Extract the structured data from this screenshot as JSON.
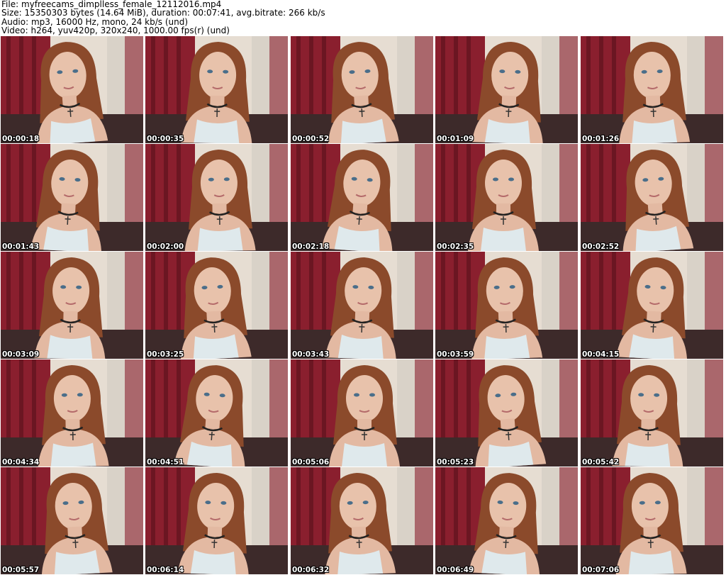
{
  "header": {
    "file_line": "File: myfreecams_dimplless_female_12112016.mp4",
    "size_line": "Size: 15350303 bytes (14.64 MiB), duration: 00:07:41, avg.bitrate: 266 kb/s",
    "audio_line": "Audio: mp3, 16000 Hz, mono, 24 kb/s (und)",
    "video_line": "Video: h264, yuv420p, 320x240, 1000.00 fps(r) (und)"
  },
  "thumbnails": [
    {
      "timestamp": "00:00:18"
    },
    {
      "timestamp": "00:00:35"
    },
    {
      "timestamp": "00:00:52"
    },
    {
      "timestamp": "00:01:09"
    },
    {
      "timestamp": "00:01:26"
    },
    {
      "timestamp": "00:01:43"
    },
    {
      "timestamp": "00:02:00"
    },
    {
      "timestamp": "00:02:18"
    },
    {
      "timestamp": "00:02:35"
    },
    {
      "timestamp": "00:02:52"
    },
    {
      "timestamp": "00:03:09"
    },
    {
      "timestamp": "00:03:25"
    },
    {
      "timestamp": "00:03:43"
    },
    {
      "timestamp": "00:03:59"
    },
    {
      "timestamp": "00:04:15"
    },
    {
      "timestamp": "00:04:34"
    },
    {
      "timestamp": "00:04:51"
    },
    {
      "timestamp": "00:05:06"
    },
    {
      "timestamp": "00:05:23"
    },
    {
      "timestamp": "00:05:42"
    },
    {
      "timestamp": "00:05:57"
    },
    {
      "timestamp": "00:06:14"
    },
    {
      "timestamp": "00:06:32"
    },
    {
      "timestamp": "00:06:49"
    },
    {
      "timestamp": "00:07:06"
    }
  ],
  "grid": {
    "columns": 5,
    "rows": 5
  }
}
